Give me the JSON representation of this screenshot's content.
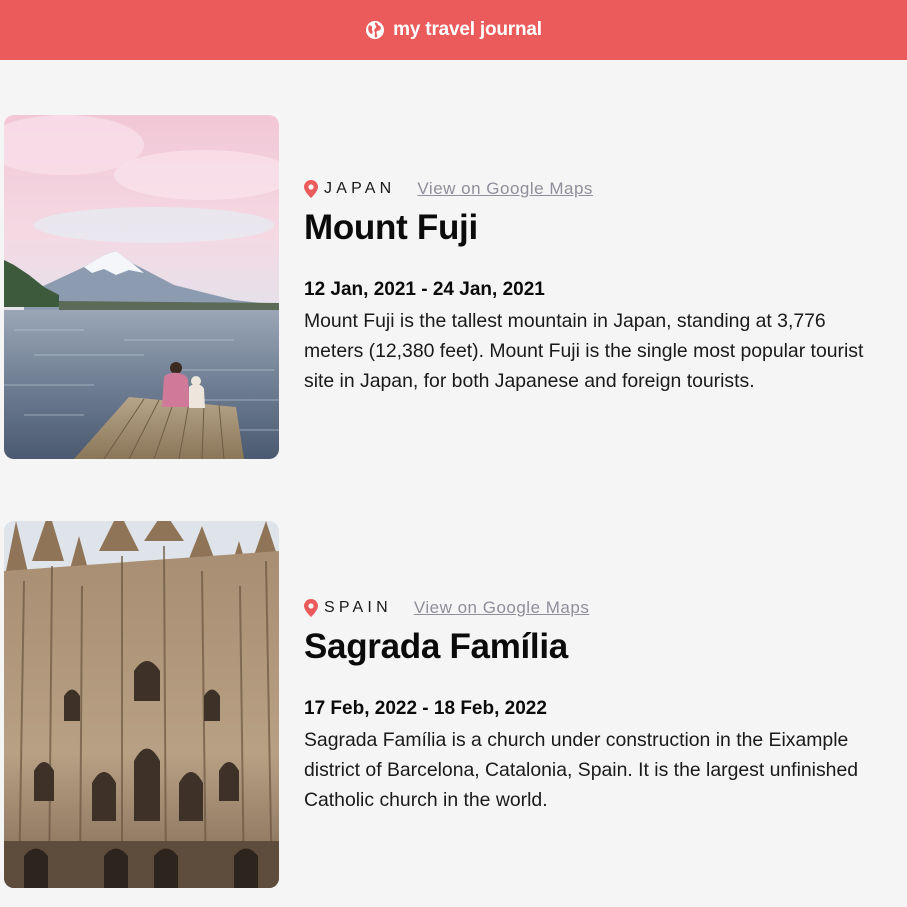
{
  "header": {
    "title": "my travel journal",
    "icon": "globe-icon",
    "bg_color": "#eb5b5b"
  },
  "entries": [
    {
      "country": "JAPAN",
      "maps_link_label": "View on Google Maps",
      "place": "Mount Fuji",
      "dates": "12 Jan, 2021 - 24 Jan, 2021",
      "description": "Mount Fuji is the tallest mountain in Japan, standing at 3,776 meters (12,380 feet). Mount Fuji is the single most popular tourist site in Japan, for both Japanese and foreign tourists."
    },
    {
      "country": "SPAIN",
      "maps_link_label": "View on Google Maps",
      "place": "Sagrada Família",
      "dates": "17 Feb, 2022 - 18 Feb, 2022",
      "description": "Sagrada Família is a church under construction in the Eixample district of Barcelona, Catalonia, Spain. It is the largest unfinished Catholic church in the world."
    }
  ],
  "colors": {
    "pin": "#eb5b5b",
    "link": "#918e9b"
  }
}
